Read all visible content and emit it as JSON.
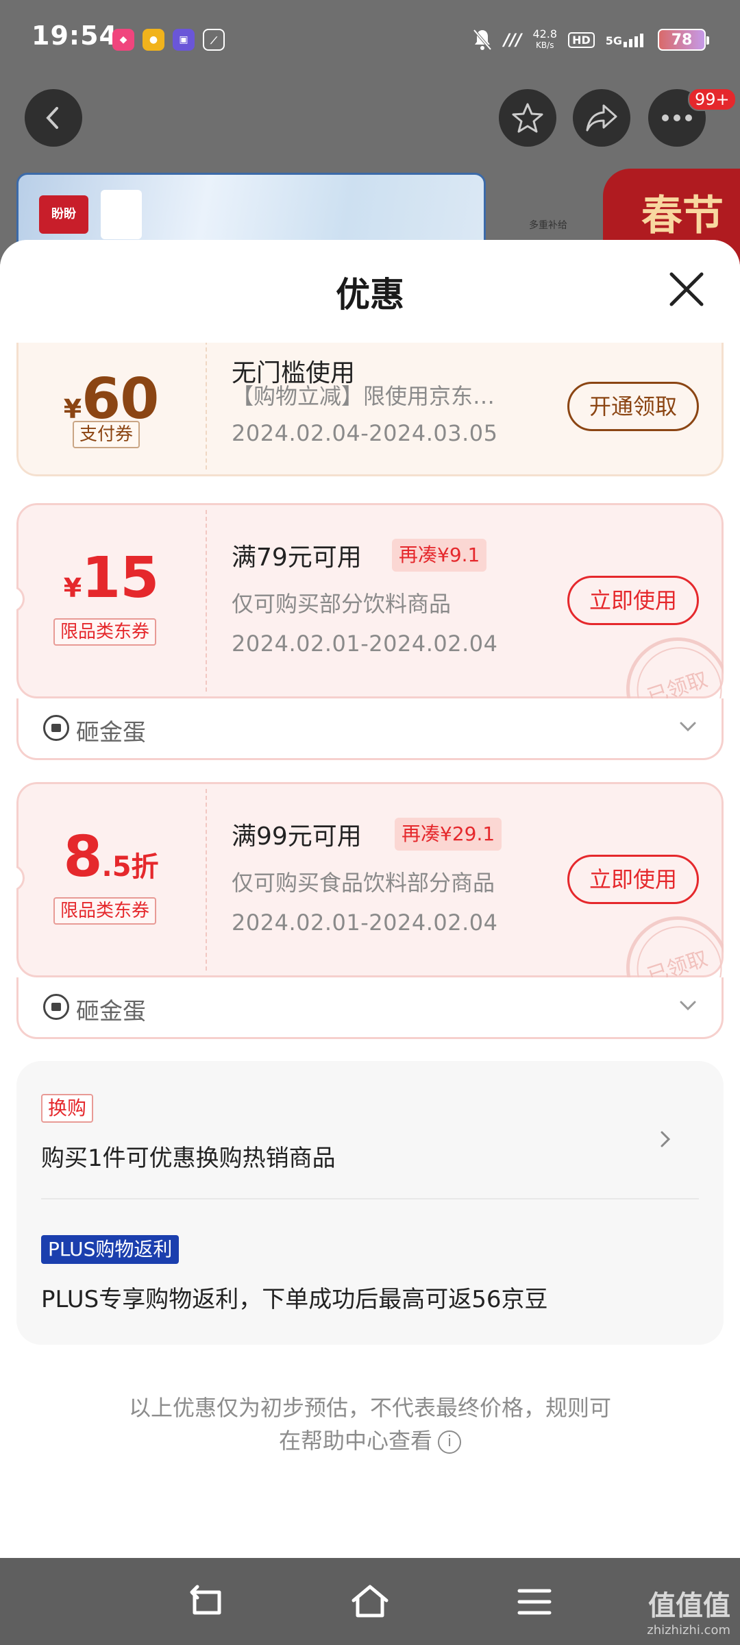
{
  "status": {
    "time": "19:54",
    "speed_value": "42.8",
    "speed_unit": "KB/s",
    "hd": "HD",
    "network": "5G",
    "battery": "78"
  },
  "background": {
    "more_badge": "99+",
    "banner_brand": "盼盼",
    "banner_note": "多重补给",
    "spring_tag": "春节"
  },
  "sheet": {
    "title": "优惠"
  },
  "coupons": [
    {
      "currency": "¥",
      "amount": "60",
      "type": "支付券",
      "condition": "无门槛使用",
      "scope": "【购物立减】限使用京东…",
      "date": "2024.02.04-2024.03.05",
      "button": "开通领取"
    },
    {
      "currency": "¥",
      "amount": "15",
      "type": "限品类东券",
      "condition": "满79元可用",
      "extra": "再凑¥9.1",
      "scope": "仅可购买部分饮料商品",
      "date": "2024.02.01-2024.02.04",
      "button": "立即使用",
      "stamp": "已领取",
      "foot": "砸金蛋"
    },
    {
      "amount_int": "8",
      "amount_dec": ".5折",
      "type": "限品类东券",
      "condition": "满99元可用",
      "extra": "再凑¥29.1",
      "scope": "仅可购买食品饮料部分商品",
      "date": "2024.02.01-2024.02.04",
      "button": "立即使用",
      "stamp": "已领取",
      "foot": "砸金蛋"
    }
  ],
  "promo": {
    "exchange_tag": "换购",
    "exchange_text": "购买1件可优惠换购热销商品",
    "plus_tag": "PLUS购物返利",
    "plus_text": "PLUS专享购物返利，下单成功后最高可返56京豆"
  },
  "disclaimer": {
    "line1": "以上优惠仅为初步预估，不代表最终价格，规则可",
    "line2": "在帮助中心查看"
  },
  "watermark": {
    "brand": "值值值",
    "site": "zhizhizhi.com"
  }
}
